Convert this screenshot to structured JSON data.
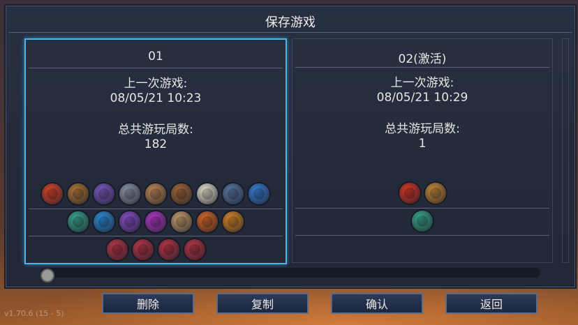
{
  "title": "保存游戏",
  "slots": [
    {
      "name": "01",
      "last_played_label": "上一次游戏:",
      "last_played": "08/05/21  10:23",
      "runs_label": "总共游玩局数:",
      "runs": "182",
      "selected": true,
      "rows": [
        [
          "red-potion-icon",
          "tome-icon",
          "scroll-icon",
          "crossbow-icon",
          "bow-icon",
          "shield-icon",
          "dice-icon",
          "armor-icon",
          "blue-orb-icon"
        ],
        [
          "green-rune-icon",
          "blue-rune-icon",
          "purple-orb-icon",
          "purple-flame-icon",
          "horn-icon",
          "spider-icon",
          "orange-rune-icon"
        ],
        [
          "eye-medallion-icon",
          "eye-medallion-icon",
          "eye-medallion-icon",
          "eye-medallion-icon"
        ]
      ]
    },
    {
      "name": "02(激活)",
      "last_played_label": "上一次游戏:",
      "last_played": "08/05/21  10:29",
      "runs_label": "总共游玩局数:",
      "runs": "1",
      "selected": false,
      "rows": [
        [
          "red-flask-icon",
          "gold-sack-icon"
        ],
        [
          "green-rune-icon"
        ],
        []
      ]
    }
  ],
  "buttons": {
    "delete": "删除",
    "copy": "复制",
    "confirm": "确认",
    "back": "返回"
  },
  "version": "v1.70.6 (15 - 5)",
  "icon_colors": {
    "red-potion-icon": "#d9472c",
    "tome-icon": "#b07a38",
    "scroll-icon": "#7a5bbf",
    "crossbow-icon": "#8a97a8",
    "bow-icon": "#c08a5a",
    "shield-icon": "#a36a3c",
    "dice-icon": "#e8e2d2",
    "armor-icon": "#5a7aa8",
    "blue-orb-icon": "#3a7fd8",
    "green-rune-icon": "#3aa890",
    "blue-rune-icon": "#2e8ed8",
    "purple-orb-icon": "#8a4fc8",
    "purple-flame-icon": "#b23ac8",
    "horn-icon": "#c8a070",
    "spider-icon": "#d86a2a",
    "orange-rune-icon": "#d88a2a",
    "eye-medallion-icon": "#b8384a",
    "red-flask-icon": "#d83a2a",
    "gold-sack-icon": "#c88a3a"
  }
}
